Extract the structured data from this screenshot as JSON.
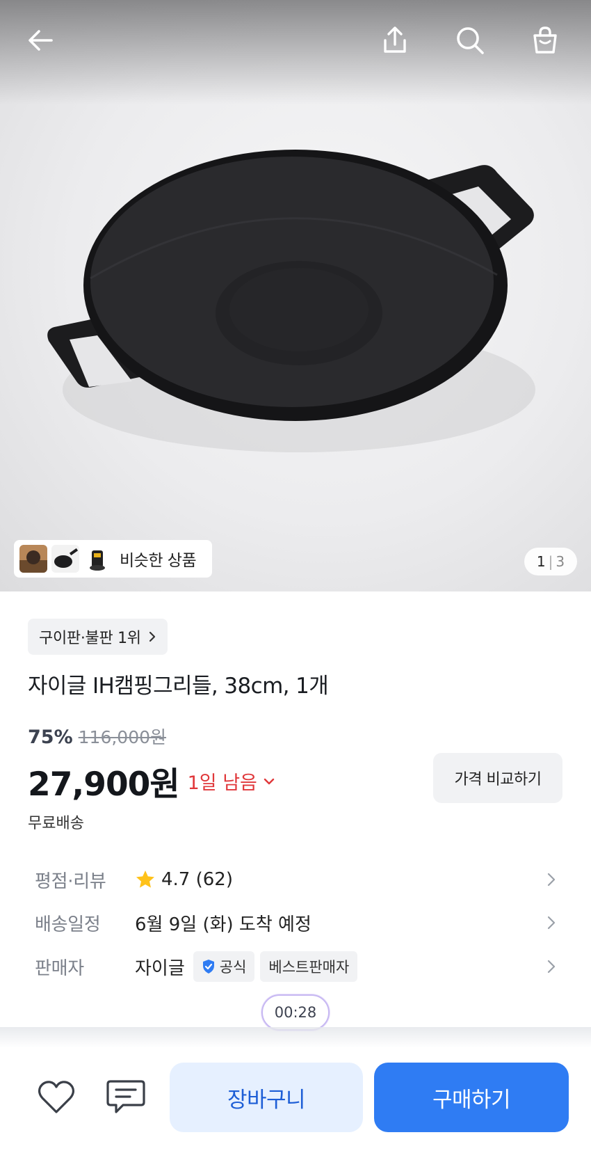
{
  "header": {
    "back_icon": "arrow-left-icon",
    "share_icon": "share-upload-icon",
    "search_icon": "search-icon",
    "cart_icon": "shopping-bag-icon"
  },
  "gallery": {
    "similar_label": "비슷한 상품",
    "current_page": "1",
    "separator": "|",
    "total_pages": "3"
  },
  "product": {
    "rank_badge": "구이판·불판 1위",
    "title": "자이글 IH캠핑그리들, 38cm, 1개",
    "discount": "75%",
    "original_price": "116,000원",
    "price": "27,900원",
    "remaining": "1일 남음",
    "compare_label": "가격 비교하기",
    "shipping": "무료배송"
  },
  "details": {
    "rating_key": "평점·리뷰",
    "rating_value": "4.7 (62)",
    "delivery_key": "배송일정",
    "delivery_value": "6월 9일 (화) 도착 예정",
    "seller_key": "판매자",
    "seller_name": "자이글",
    "official_badge": "공식",
    "best_seller_badge": "베스트판매자"
  },
  "timer": "00:28",
  "bottom_bar": {
    "wishlist_icon": "heart-icon",
    "chat_icon": "chat-icon",
    "cart_label": "장바구니",
    "buy_label": "구매하기"
  },
  "colors": {
    "accent_blue": "#2f7cf3",
    "sale_red": "#e0373a",
    "star_yellow": "#ffc21a",
    "official_blue": "#2f7cf3"
  }
}
